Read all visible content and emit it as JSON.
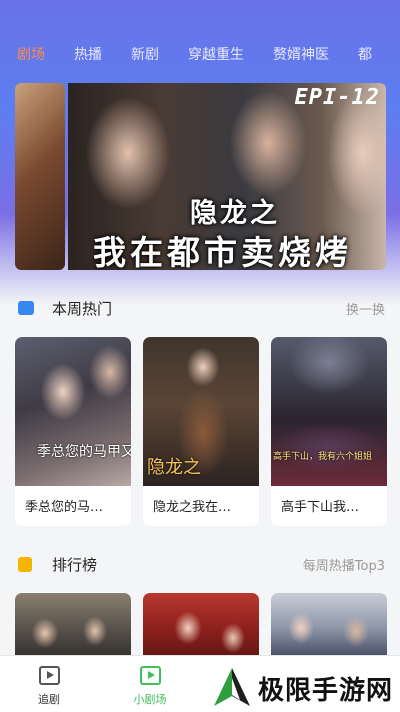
{
  "tabs": [
    {
      "label": "剧场",
      "active": true
    },
    {
      "label": "热播",
      "active": false
    },
    {
      "label": "新剧",
      "active": false
    },
    {
      "label": "穿越重生",
      "active": false
    },
    {
      "label": "赘婿神医",
      "active": false
    },
    {
      "label": "都",
      "active": false
    }
  ],
  "banner": {
    "episode_text": "EPI-12",
    "title_line1": "隐龙之",
    "title_line2": "我在都市卖烧烤"
  },
  "weekly": {
    "title": "本周热门",
    "more": "换一换",
    "icon": "video-icon",
    "icon_color": "#3a86f0",
    "items": [
      {
        "title": "季总您的马…",
        "poster_text": "季总您的马甲又掉了"
      },
      {
        "title": "隐龙之我在…",
        "poster_text": "隐龙之"
      },
      {
        "title": "高手下山我…",
        "poster_text": "高手下山，我有六个姐姐"
      }
    ]
  },
  "ranking": {
    "title": "排行榜",
    "more": "每周热播Top3",
    "icon": "bookmark-icon",
    "icon_color": "#f5b400"
  },
  "nav": {
    "items": [
      {
        "label": "追剧",
        "active": false
      },
      {
        "label": "小剧场",
        "active": true
      }
    ]
  },
  "watermark": {
    "text": "极限手游网"
  },
  "colors": {
    "accent": "#3fbf5a",
    "tab_active": "#ff8a4d"
  }
}
